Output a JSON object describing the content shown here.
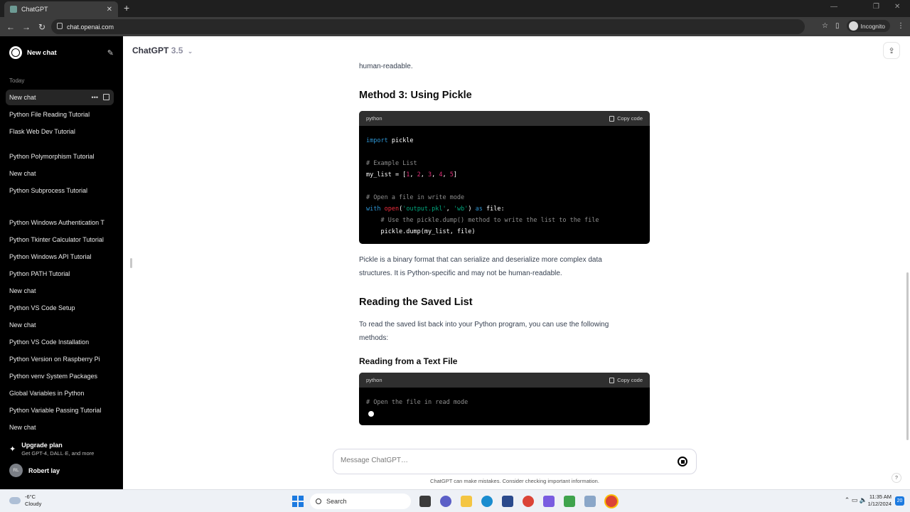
{
  "browser": {
    "tab_title": "ChatGPT",
    "tab_close": "✕",
    "new_tab": "+",
    "url": "chat.openai.com",
    "incognito_label": "Incognito",
    "back": "←",
    "forward": "→",
    "reload": "↻",
    "star": "☆",
    "menu": "⋮",
    "minimize": "—",
    "maximize": "❐",
    "close": "✕"
  },
  "sidebar": {
    "new_chat_label": "New chat",
    "edit_icon": "✎",
    "section_today": "Today",
    "items": [
      {
        "label": "New chat"
      },
      {
        "label": "Python File Reading Tutorial"
      },
      {
        "label": "Flask Web Dev Tutorial"
      },
      {
        "label": "Python Polymorphism Tutorial"
      },
      {
        "label": "New chat"
      },
      {
        "label": "Python Subprocess Tutorial"
      },
      {
        "label": "Python Windows Authentication T"
      },
      {
        "label": "Python Tkinter Calculator Tutorial"
      },
      {
        "label": "Python Windows API Tutorial"
      },
      {
        "label": "Python PATH Tutorial"
      },
      {
        "label": "New chat"
      },
      {
        "label": "Python VS Code Setup"
      },
      {
        "label": "New chat"
      },
      {
        "label": "Python VS Code Installation"
      },
      {
        "label": "Python Version on Raspberry Pi"
      },
      {
        "label": "Python venv System Packages"
      },
      {
        "label": "Global Variables in Python"
      },
      {
        "label": "Python Variable Passing Tutorial"
      },
      {
        "label": "New chat"
      }
    ],
    "active_dots": "•••",
    "upgrade_title": "Upgrade plan",
    "upgrade_subtitle": "Get GPT-4, DALL·E, and more",
    "upgrade_icon": "✦",
    "user_initials": "RL",
    "user_name": "Robert lay"
  },
  "main": {
    "model_name": "ChatGPT",
    "model_version": "3.5",
    "model_chevron": "⌄",
    "share_icon": "⇪",
    "top_fragment": "human-readable.",
    "h_method3": "Method 3: Using Pickle",
    "code1_lang": "python",
    "copy_label": "Copy code",
    "p_pickle_line1": "Pickle is a binary format that can serialize and deserialize more complex data",
    "p_pickle_line2": "structures. It is Python-specific and may not be human-readable.",
    "h_reading": "Reading the Saved List",
    "p_reading_line1": "To read the saved list back into your Python program, you can use the following",
    "p_reading_line2": "methods:",
    "h_text_file": "Reading from a Text File",
    "code2_lang": "python",
    "code2_line1": "# Open the file in read mode",
    "composer_placeholder": "Message ChatGPT…",
    "disclaimer": "ChatGPT can make mistakes. Consider checking important information.",
    "help": "?"
  },
  "code1": {
    "l1_kw": "import",
    "l1_rest": " pickle",
    "l2": "# Example List",
    "l3_a": "my_list = [",
    "n1": "1",
    "n2": "2",
    "n3": "3",
    "n4": "4",
    "n5": "5",
    "comma": ", ",
    "l3_end": "]",
    "l4": "# Open a file in write mode",
    "l5_with": "with",
    "l5_open": "open",
    "l5_p1": "(",
    "l5_s1": "'output.pkl'",
    "l5_c": ", ",
    "l5_s2": "'wb'",
    "l5_p2": ") ",
    "l5_as": "as",
    "l5_end": " file:",
    "l6": "    # Use the pickle.dump() method to write the list to the file",
    "l7": "    pickle.dump(my_list, file)"
  },
  "taskbar": {
    "temp": "-6°C",
    "condition": "Cloudy",
    "search": "Search",
    "time": "11:35 AM",
    "date": "1/12/2024",
    "notifications": "20",
    "tray_icons": "⌃  ▭  🔈"
  },
  "colors": {
    "sidebar_bg": "#000000",
    "accent_blue": "#2e95d3",
    "code_string": "#00a67d",
    "code_number": "#df3079"
  }
}
